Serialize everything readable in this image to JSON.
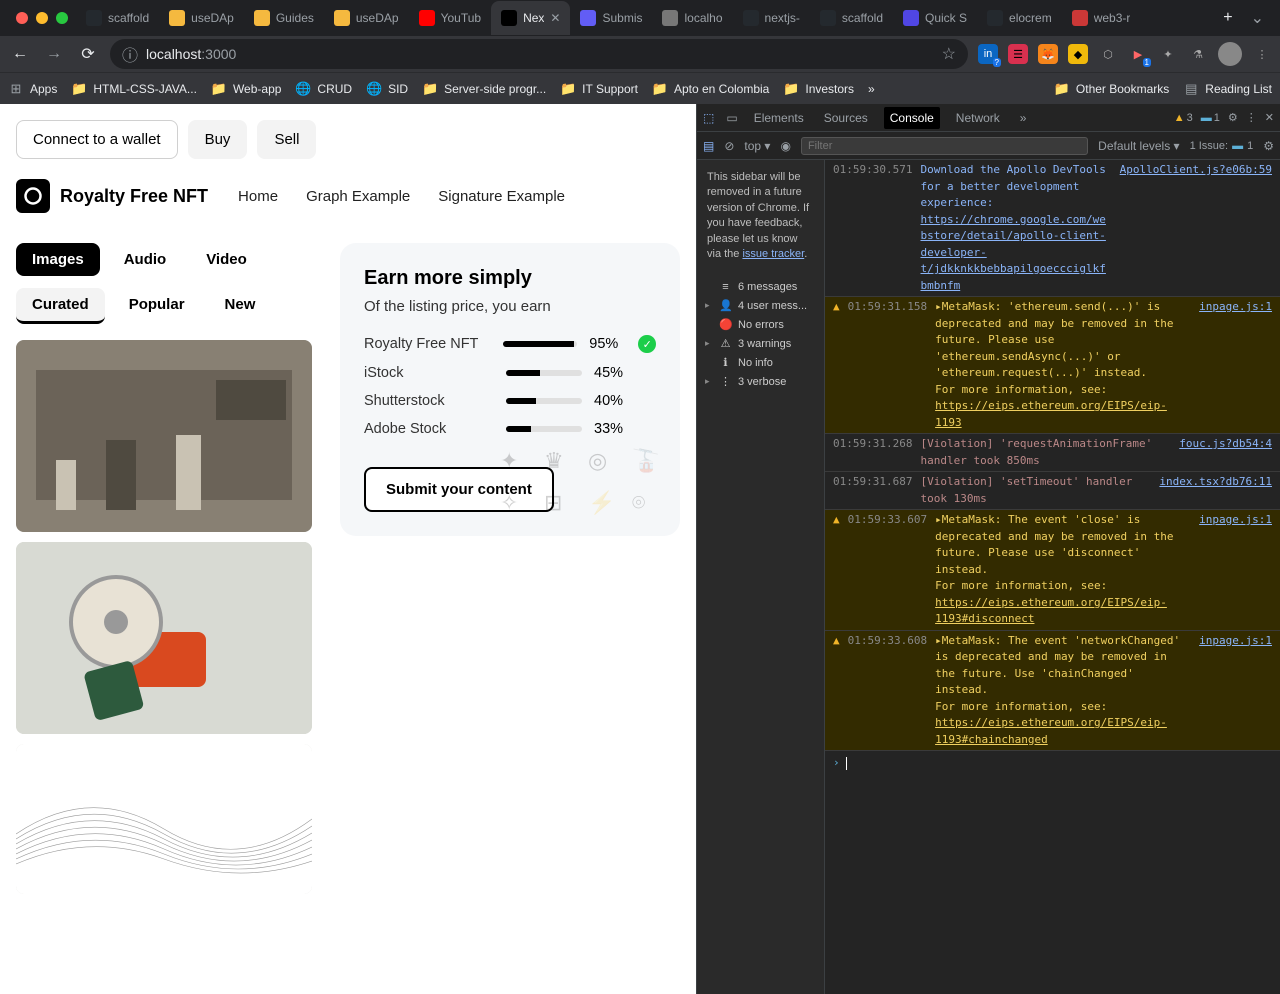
{
  "chrome": {
    "tabs": [
      {
        "label": "scaffold",
        "icon": "github"
      },
      {
        "label": "useDAp",
        "icon": "hs"
      },
      {
        "label": "Guides",
        "icon": "hs"
      },
      {
        "label": "useDAp",
        "icon": "hs"
      },
      {
        "label": "YouTub",
        "icon": "yt"
      },
      {
        "label": "Nex",
        "icon": "tri",
        "active": true
      },
      {
        "label": "Submis",
        "icon": "loom"
      },
      {
        "label": "localho",
        "icon": "globe"
      },
      {
        "label": "nextjs-",
        "icon": "github"
      },
      {
        "label": "scaffold",
        "icon": "github"
      },
      {
        "label": "Quick S",
        "icon": "q"
      },
      {
        "label": "elocrem",
        "icon": "github"
      },
      {
        "label": "web3-r",
        "icon": "npm"
      }
    ],
    "url_host": "localhost",
    "url_path": ":3000",
    "bookmarks": [
      "Apps",
      "HTML-CSS-JAVA...",
      "Web-app",
      "CRUD",
      "SID",
      "Server-side progr...",
      "IT Support",
      "Apto en Colombia",
      "Investors"
    ],
    "bm_overflow": "»",
    "other_bookmarks": "Other Bookmarks",
    "reading_list": "Reading List"
  },
  "page": {
    "connect": "Connect to a wallet",
    "buy": "Buy",
    "sell": "Sell",
    "brand": "Royalty Free NFT",
    "nav": [
      "Home",
      "Graph Example",
      "Signature Example"
    ],
    "media_tabs": [
      "Images",
      "Audio",
      "Video"
    ],
    "filter_tabs": [
      "Curated",
      "Popular",
      "New"
    ],
    "card": {
      "title": "Earn more simply",
      "subtitle": "Of the listing price, you earn",
      "rows": [
        {
          "label": "Royalty Free NFT",
          "pct": "95%",
          "fill": 95,
          "check": true
        },
        {
          "label": "iStock",
          "pct": "45%",
          "fill": 45
        },
        {
          "label": "Shutterstock",
          "pct": "40%",
          "fill": 40
        },
        {
          "label": "Adobe Stock",
          "pct": "33%",
          "fill": 33
        }
      ],
      "submit": "Submit your content"
    }
  },
  "devtools": {
    "tabs": [
      "Elements",
      "Sources",
      "Console",
      "Network"
    ],
    "warn_count": "3",
    "msg_count": "1",
    "toolbar_top": "top ▾",
    "filter_ph": "Filter",
    "levels": "Default levels ▾",
    "issues_label": "1 Issue:",
    "issues_count": "1",
    "sidebar_warning": "This sidebar will be removed in a future version of Chrome. If you have feedback, please let us know via the ",
    "sidebar_link": "issue tracker",
    "groups": [
      {
        "icon": "≡",
        "label": "6 messages"
      },
      {
        "icon": "👤",
        "label": "4 user mess...",
        "expandable": true
      },
      {
        "icon": "🔴",
        "label": "No errors"
      },
      {
        "icon": "⚠",
        "label": "3 warnings",
        "expandable": true
      },
      {
        "icon": "ℹ",
        "label": "No info"
      },
      {
        "icon": "⋮",
        "label": "3 verbose",
        "expandable": true
      }
    ],
    "logs": [
      {
        "type": "info",
        "ts": "01:59:30.571",
        "body": "Download the Apollo DevTools for a better development experience: https://chrome.google.com/webstore/detail/apollo-client-developer-t/jdkknkkbebbapilgoeccciglkfbmbnfm",
        "src": "ApolloClient.js?e06b:59"
      },
      {
        "type": "warn",
        "ts": "01:59:31.158",
        "body": "▸MetaMask: 'ethereum.send(...)' is deprecated and may be removed in the future. Please use 'ethereum.sendAsync(...)' or 'ethereum.request(...)' instead.\nFor more information, see: https://eips.ethereum.org/EIPS/eip-1193",
        "src": "inpage.js:1"
      },
      {
        "type": "violation",
        "ts": "01:59:31.268",
        "body": "[Violation] 'requestAnimationFrame' handler took 850ms",
        "src": "fouc.js?db54:4"
      },
      {
        "type": "violation",
        "ts": "01:59:31.687",
        "body": "[Violation] 'setTimeout' handler took 130ms",
        "src": "index.tsx?db76:11"
      },
      {
        "type": "warn",
        "ts": "01:59:33.607",
        "body": "▸MetaMask: The event 'close' is deprecated and may be removed in the future. Please use 'disconnect' instead.\nFor more information, see: https://eips.ethereum.org/EIPS/eip-1193#disconnect",
        "src": "inpage.js:1"
      },
      {
        "type": "warn",
        "ts": "01:59:33.608",
        "body": "▸MetaMask: The event 'networkChanged' is deprecated and may be removed in the future. Use 'chainChanged' instead.\nFor more information, see: https://eips.ethereum.org/EIPS/eip-1193#chainchanged",
        "src": "inpage.js:1"
      }
    ],
    "prompt": "›"
  }
}
